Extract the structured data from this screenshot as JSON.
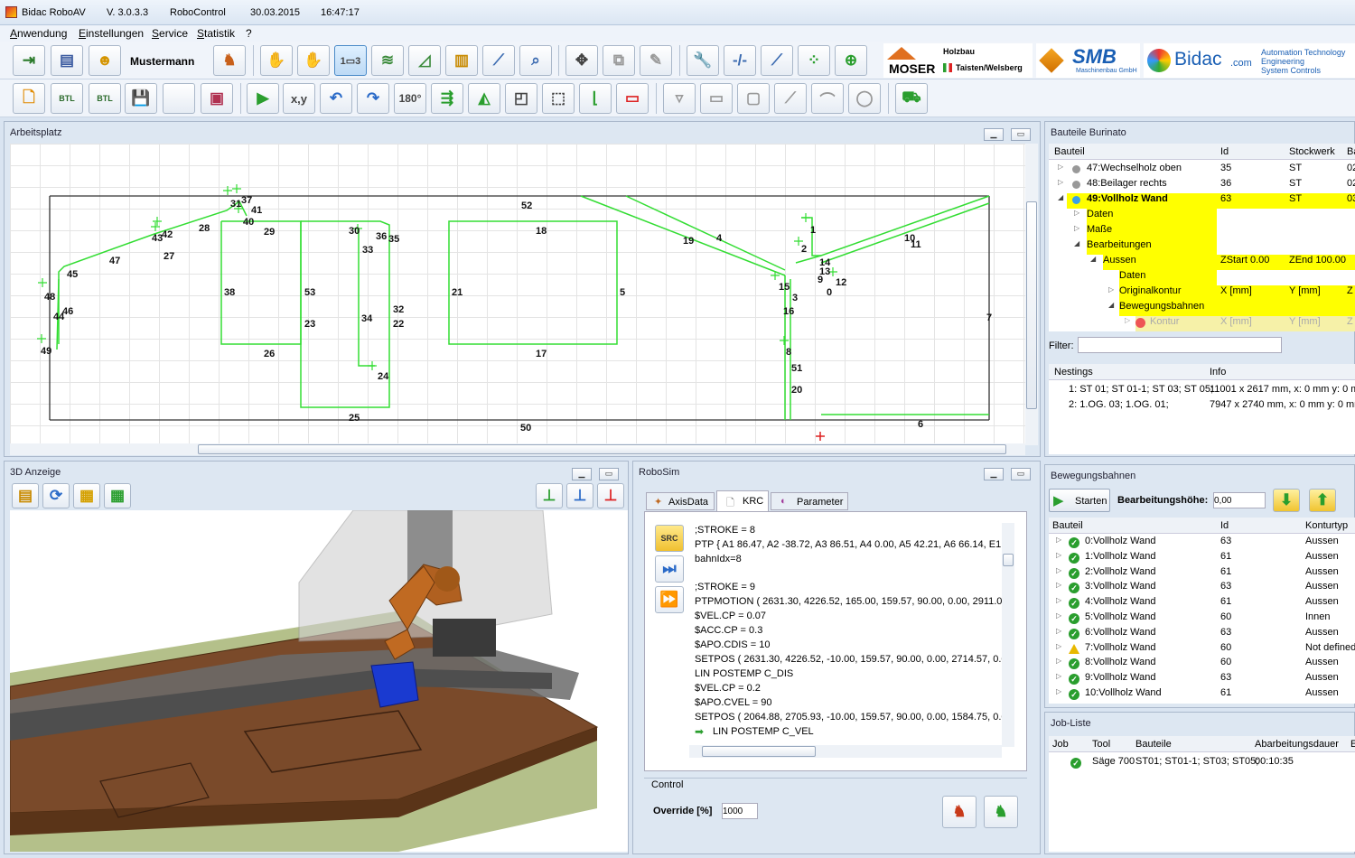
{
  "titlebar": {
    "app": "Bidac RoboAV",
    "version": "V. 3.0.3.3",
    "module": "RoboControl",
    "date": "30.03.2015",
    "time": "16:47:17"
  },
  "menu": [
    "Anwendung",
    "Einstellungen",
    "Service",
    "Statistik",
    "?"
  ],
  "toolbar": {
    "user": "Mustermann",
    "icons": [
      "exit-icon",
      "database-icon",
      "user-icon",
      "robot-icon",
      "hand-move-icon",
      "hand-rotate-icon",
      "numbered-frame-icon",
      "layers-icon",
      "angle-icon",
      "fence-icon",
      "laser-icon",
      "zoom-fit-icon",
      "move-arrows-icon",
      "overlap-icon",
      "edit-doc-icon",
      "wrench-icon",
      "line-dash-icon",
      "line-icon",
      "points-icon",
      "add-robot-icon"
    ]
  },
  "toolbar2": {
    "rotate_label": "180°",
    "xy_label": "x,y",
    "icons": [
      "new-doc-icon",
      "btl-import-icon",
      "btl-export-icon",
      "save-icon",
      "blank-icon",
      "open-box-icon",
      "play-icon",
      "xy-move-icon",
      "undo-icon",
      "redo-icon",
      "rotate-180-icon",
      "mirror-h-icon",
      "mirror-v-icon",
      "resize-icon",
      "crop-icon",
      "origin-icon",
      "delete-frame-icon",
      "cutter-icon",
      "rect-icon",
      "rect-2-icon",
      "diag-line-icon",
      "arc-icon",
      "circle-icon",
      "machine-icon"
    ]
  },
  "logos": {
    "moser_top": "Holzbau",
    "moser_name": "MOSER",
    "moser_sub": "Taisten/Welsberg",
    "smb": "SMB",
    "smb_sub": "Maschinenbau GmbH",
    "bidac": "Bidac",
    "bidac_com": ".com",
    "bidac_lines": [
      "Automation Technology",
      "Engineering",
      "System Controls"
    ]
  },
  "arbeitsplatz": {
    "title": "Arbeitsplatz",
    "labels": [
      {
        "t": "37"
      },
      {
        "t": "31"
      },
      {
        "t": "41"
      },
      {
        "t": "40"
      },
      {
        "t": "29"
      },
      {
        "t": "28"
      },
      {
        "t": "43"
      },
      {
        "t": "42"
      },
      {
        "t": "27"
      },
      {
        "t": "47"
      },
      {
        "t": "45"
      },
      {
        "t": "48"
      },
      {
        "t": "46"
      },
      {
        "t": "44"
      },
      {
        "t": "49"
      },
      {
        "t": "38"
      },
      {
        "t": "26"
      },
      {
        "t": "53"
      },
      {
        "t": "23"
      },
      {
        "t": "30"
      },
      {
        "t": "36"
      },
      {
        "t": "35"
      },
      {
        "t": "33"
      },
      {
        "t": "34"
      },
      {
        "t": "32"
      },
      {
        "t": "22"
      },
      {
        "t": "24"
      },
      {
        "t": "25"
      },
      {
        "t": "52"
      },
      {
        "t": "18"
      },
      {
        "t": "21"
      },
      {
        "t": "5"
      },
      {
        "t": "17"
      },
      {
        "t": "50"
      },
      {
        "t": "19"
      },
      {
        "t": "4"
      },
      {
        "t": "1"
      },
      {
        "t": "2"
      },
      {
        "t": "14"
      },
      {
        "t": "13"
      },
      {
        "t": "9"
      },
      {
        "t": "12"
      },
      {
        "t": "0"
      },
      {
        "t": "15"
      },
      {
        "t": "3"
      },
      {
        "t": "16"
      },
      {
        "t": "8"
      },
      {
        "t": "51"
      },
      {
        "t": "20"
      },
      {
        "t": "10"
      },
      {
        "t": "11"
      },
      {
        "t": "7"
      },
      {
        "t": "6"
      }
    ]
  },
  "bauteile": {
    "title": "Bauteile Burinato",
    "columns": [
      "Bauteil",
      "Id",
      "Stockwerk",
      "Ba"
    ],
    "rows": [
      {
        "name": "47:Wechselholz oben",
        "id": "35",
        "st": "ST",
        "b": "02"
      },
      {
        "name": "48:Beilager rechts",
        "id": "36",
        "st": "ST",
        "b": "02"
      },
      {
        "name": "49:Vollholz Wand",
        "id": "63",
        "st": "ST",
        "b": "03"
      }
    ],
    "tree": [
      "Daten",
      "Maße",
      "Bearbeitungen",
      "Aussen",
      "Daten",
      "Originalkontur",
      "Bewegungsbahnen",
      "Kontur"
    ],
    "aussen_cols": [
      "ZStart 0.00",
      "ZEnd 100.00"
    ],
    "orig_cols": [
      "X [mm]",
      "Y [mm]",
      "Z"
    ],
    "kontur_cols": [
      "X [mm]",
      "Y [mm]",
      "Z"
    ],
    "filter_label": "Filter:",
    "filter_value": "",
    "nestings_cols": [
      "Nestings",
      "Info"
    ],
    "nestings": [
      {
        "n": "1: ST 01; ST 01-1; ST 03; ST 05;",
        "i": "11001 x 2617 mm, x: 0 mm y: 0 m"
      },
      {
        "n": "2: 1.OG. 03; 1.OG. 01;",
        "i": "7947 x 2740 mm, x: 0 mm y: 0 mm"
      }
    ]
  },
  "anzeige3d": {
    "title": "3D Anzeige"
  },
  "robosim": {
    "title": "RoboSim",
    "tabs": [
      "AxisData",
      "KRC",
      "Parameter"
    ],
    "code": [
      ";STROKE = 8",
      "PTP { A1 86.47, A2 -38.72, A3 86.51, A4 0.00, A5 42.21, A6 66.14, E1 291",
      "bahnIdx=8",
      "",
      ";STROKE = 9",
      "PTPMOTION ( 2631.30, 4226.52, 165.00, 159.57, 90.00, 0.00, 2911.00, 0.0",
      "$VEL.CP = 0.07",
      "$ACC.CP = 0.3",
      "$APO.CDIS = 10",
      "SETPOS ( 2631.30, 4226.52, -10.00, 159.57, 90.00, 0.00, 2714.57, 0.00, 0.0",
      "LIN POSTEMP C_DIS",
      "$VEL.CP = 0.2",
      "$APO.CVEL = 90",
      "SETPOS ( 2064.88, 2705.93, -10.00, 159.57, 90.00, 0.00, 1584.75, 0.00, 0.0",
      "LIN POSTEMP C_VEL"
    ],
    "src_label": "SRC",
    "control_title": "Control",
    "override_label": "Override [%]",
    "override_value": "1000"
  },
  "bewegung": {
    "title": "Bewegungsbahnen",
    "start": "Starten",
    "hoehe_label": "Bearbeitungshöhe:",
    "hoehe_value": "0,00",
    "columns": [
      "Bauteil",
      "Id",
      "Konturtyp"
    ],
    "rows": [
      {
        "name": "0:Vollholz Wand",
        "id": "63",
        "typ": "Aussen",
        "status": "ok"
      },
      {
        "name": "1:Vollholz Wand",
        "id": "61",
        "typ": "Aussen",
        "status": "ok"
      },
      {
        "name": "2:Vollholz Wand",
        "id": "61",
        "typ": "Aussen",
        "status": "ok"
      },
      {
        "name": "3:Vollholz Wand",
        "id": "63",
        "typ": "Aussen",
        "status": "ok"
      },
      {
        "name": "4:Vollholz Wand",
        "id": "61",
        "typ": "Aussen",
        "status": "ok"
      },
      {
        "name": "5:Vollholz Wand",
        "id": "60",
        "typ": "Innen",
        "status": "ok"
      },
      {
        "name": "6:Vollholz Wand",
        "id": "63",
        "typ": "Aussen",
        "status": "ok"
      },
      {
        "name": "7:Vollholz Wand",
        "id": "60",
        "typ": "Not defined",
        "status": "warn"
      },
      {
        "name": "8:Vollholz Wand",
        "id": "60",
        "typ": "Aussen",
        "status": "ok"
      },
      {
        "name": "9:Vollholz Wand",
        "id": "63",
        "typ": "Aussen",
        "status": "ok"
      },
      {
        "name": "10:Vollholz Wand",
        "id": "61",
        "typ": "Aussen",
        "status": "ok"
      }
    ]
  },
  "jobliste": {
    "title": "Job-Liste",
    "columns": [
      "Job",
      "Tool",
      "Bauteile",
      "Abarbeitungsdauer",
      "E"
    ],
    "rows": [
      {
        "tool": "Säge 700",
        "bauteile": "ST01; ST01-1; ST03; ST05;",
        "dauer": "00:10:35"
      }
    ]
  },
  "colors": {
    "green_line": "#33dd33",
    "highlight": "#ffff00",
    "panel": "#dde7f2"
  }
}
